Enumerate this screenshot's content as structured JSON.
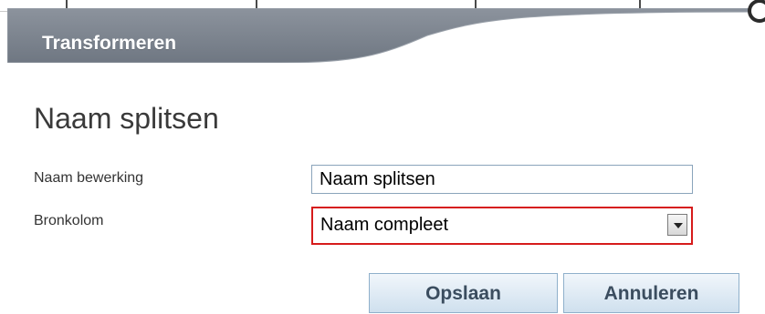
{
  "header": {
    "title": "Transformeren"
  },
  "page": {
    "title": "Naam splitsen"
  },
  "form": {
    "operation_name": {
      "label": "Naam bewerking",
      "value": "Naam splitsen"
    },
    "source_column": {
      "label": "Bronkolom",
      "selected": "Naam compleet",
      "highlight_color": "#d61b1b"
    }
  },
  "actions": {
    "save_label": "Opslaan",
    "cancel_label": "Annuleren"
  },
  "colors": {
    "header_band": "#7f8792",
    "button_text": "#3b4d5f",
    "input_border": "#8aa4bb"
  },
  "icons": {
    "corner": "circle-icon",
    "dropdown": "chevron-down-icon"
  }
}
